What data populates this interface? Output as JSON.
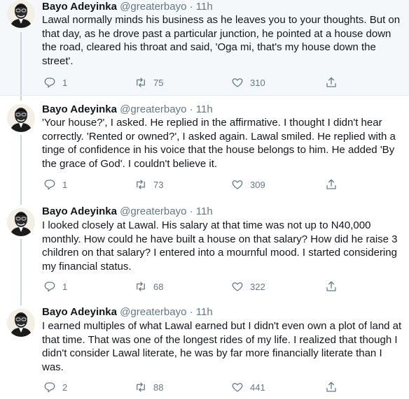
{
  "author": {
    "name": "Bayo Adeyinka",
    "handle": "@greaterbayo",
    "separator": "·",
    "time": "11h"
  },
  "tweets": [
    {
      "text": "Lawal normally minds his business as he leaves you to your thoughts. But on that day, as he drove past a particular junction, he pointed at a house down the road, cleared his throat and said, 'Oga mi, that's my house down the street'.",
      "replies": "1",
      "retweets": "75",
      "likes": "310"
    },
    {
      "text": "'Your house?', I asked. He replied in the affirmative. I thought I didn't hear correctly. 'Rented or owned?', I asked again. Lawal smiled. He replied with a tinge of confidence in his voice that the house belongs to him. He added 'By the grace of God'. I couldn't believe it.",
      "replies": "1",
      "retweets": "73",
      "likes": "309"
    },
    {
      "text": "I looked closely at Lawal. His salary at that time was not up to N40,000 monthly. How could he have built a house on that salary? How did he raise 3 children on that salary? I entered into a mournful mood. I started considering my financial status.",
      "replies": "1",
      "retweets": "68",
      "likes": "322"
    },
    {
      "text": "I earned multiples of what Lawal earned but I didn't even own a plot of land at that time. That was one of the longest rides of my life. I realized that though I didn't consider Lawal literate, he was by far more financially literate than I was.",
      "replies": "2",
      "retweets": "88",
      "likes": "441"
    }
  ],
  "colors": {
    "text": "#14171a",
    "muted": "#657786",
    "highlight_bg": "#f5f8fa",
    "divider": "#e6ecf0"
  }
}
